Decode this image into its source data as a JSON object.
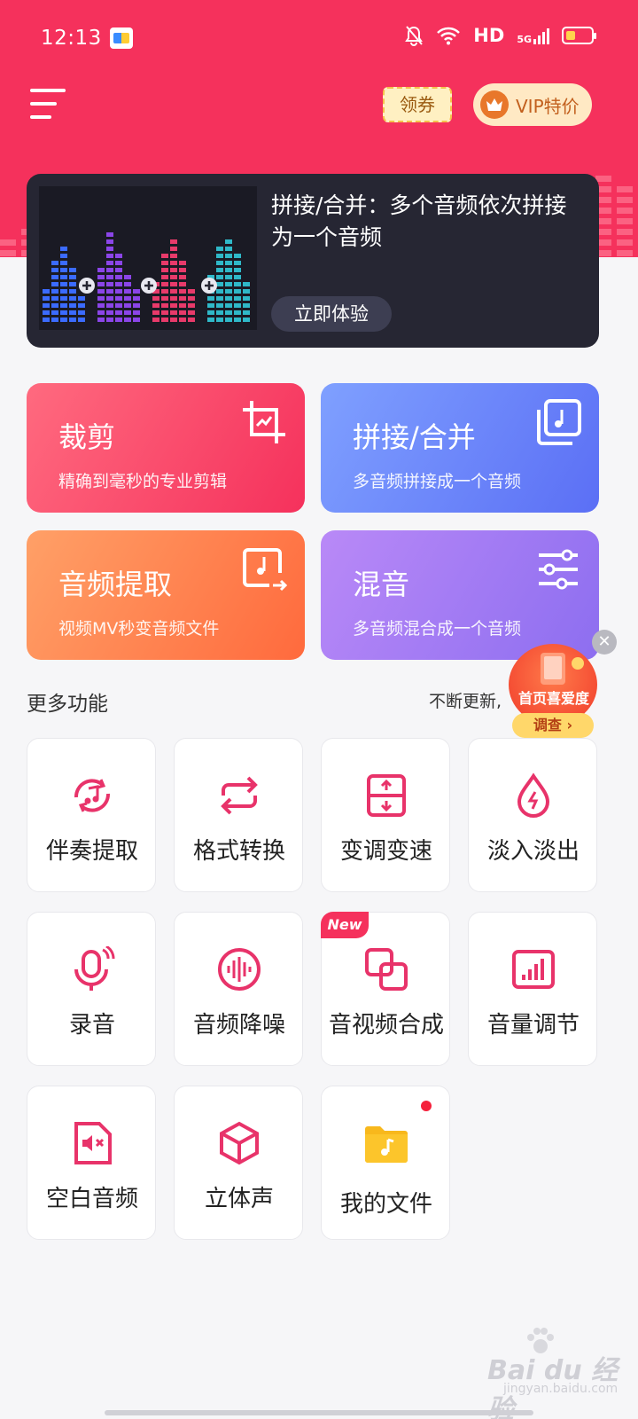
{
  "colors": {
    "brand": "#f5315c",
    "accent_icon": "#e8336a",
    "banner_bg": "#262633",
    "vip_text": "#c25f1d"
  },
  "status_bar": {
    "time": "12:13",
    "network": "HD",
    "signal": "5G",
    "icons": [
      "app-icon",
      "mute-icon",
      "wifi-icon",
      "signal-icon",
      "battery-icon"
    ]
  },
  "header": {
    "coupon_label": "领券",
    "vip_label": "VIP特价"
  },
  "banner": {
    "title": "拼接/合并：多个音频依次拼接为一个音频",
    "cta_label": "立即体验"
  },
  "feature_cards": [
    {
      "title": "裁剪",
      "subtitle": "精确到毫秒的专业剪辑",
      "icon": "crop-icon"
    },
    {
      "title": "拼接/合并",
      "subtitle": "多音频拼接成一个音频",
      "icon": "merge-icon"
    },
    {
      "title": "音频提取",
      "subtitle": "视频MV秒变音频文件",
      "icon": "extract-icon"
    },
    {
      "title": "混音",
      "subtitle": "多音频混合成一个音频",
      "icon": "sliders-icon"
    }
  ],
  "more": {
    "title": "更多功能",
    "hint": "不断更新,"
  },
  "tools": [
    {
      "label": "伴奏提取",
      "icon": "accompaniment-icon"
    },
    {
      "label": "格式转换",
      "icon": "convert-icon"
    },
    {
      "label": "变调变速",
      "icon": "pitch-speed-icon"
    },
    {
      "label": "淡入淡出",
      "icon": "fade-icon"
    },
    {
      "label": "录音",
      "icon": "microphone-icon"
    },
    {
      "label": "音频降噪",
      "icon": "denoise-icon"
    },
    {
      "label": "音视频合成",
      "icon": "compose-icon",
      "badge": "New"
    },
    {
      "label": "音量调节",
      "icon": "volume-icon"
    },
    {
      "label": "空白音频",
      "icon": "blank-audio-icon"
    },
    {
      "label": "立体声",
      "icon": "stereo-icon"
    },
    {
      "label": "我的文件",
      "icon": "folder-icon",
      "has_dot": true
    }
  ],
  "survey": {
    "title": "首页喜爱度",
    "button": "调查 ›"
  },
  "watermark": {
    "text": "Bai du 经验",
    "sub": "jingyan.baidu.com"
  }
}
